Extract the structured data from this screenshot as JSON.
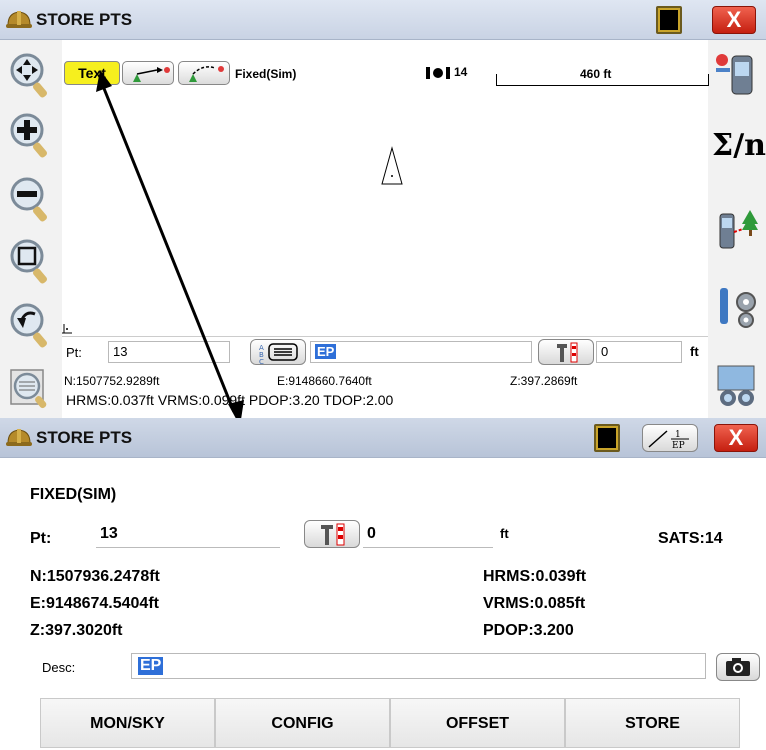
{
  "top_window": {
    "title": "STORE PTS",
    "close_label": "X",
    "map_toolbar": {
      "text_button": "Text",
      "fix_status": "Fixed(Sim)",
      "satellites": "14",
      "scale": "460 ft"
    },
    "point_row": {
      "pt_label": "Pt:",
      "pt_value": "13",
      "desc_value": "EP",
      "rod_height": "0",
      "units": "ft"
    },
    "coords": {
      "northing": "N:1507752.9289ft",
      "easting": "E:9148660.7640ft",
      "elevation": "Z:397.2869ft",
      "quality": "HRMS:0.037ft VRMS:0.099ft PDOP:3.20 TDOP:2.00"
    },
    "right_tools": {
      "sum_icon_text": "Σ/n"
    }
  },
  "bottom_window": {
    "title": "STORE PTS",
    "close_label": "X",
    "ep_button": "EP",
    "ep_button_num": "1",
    "fix_status": "FIXED(SIM)",
    "pt_label": "Pt:",
    "pt_value": "13",
    "rod_height": "0",
    "units": "ft",
    "sats": "SATS:14",
    "northing": "N:1507936.2478ft",
    "easting": "E:9148674.5404ft",
    "elevation": "Z:397.3020ft",
    "hrms": "HRMS:0.039ft",
    "vrms": "VRMS:0.085ft",
    "pdop": "PDOP:3.200",
    "desc_label": "Desc:",
    "desc_value": "EP",
    "buttons": [
      "MON/SKY",
      "CONFIG",
      "OFFSET",
      "STORE"
    ]
  },
  "colors": {
    "titlebar": "#c9d3e4",
    "close": "#d92c1a",
    "text_button": "#f6ef1e",
    "selection": "#2e6fd8"
  }
}
